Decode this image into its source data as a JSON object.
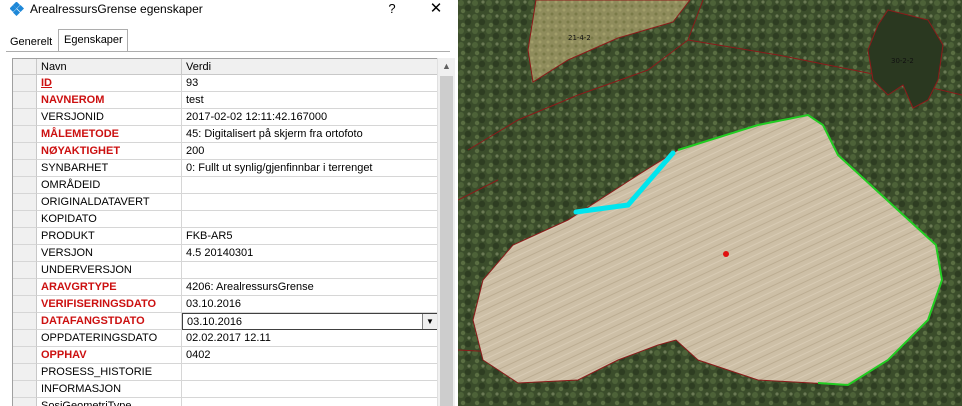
{
  "window": {
    "title": "ArealressursGrense egenskaper",
    "help_label": "?",
    "close_label": "✕",
    "icon": "diamond-app-icon"
  },
  "tabs": [
    {
      "label": "Generelt",
      "active": false
    },
    {
      "label": "Egenskaper",
      "active": true
    }
  ],
  "grid": {
    "headers": {
      "name": "Navn",
      "value": "Verdi"
    },
    "rows": [
      {
        "name": "ID",
        "value": "93",
        "required": true,
        "selected": true
      },
      {
        "name": "NAVNEROM",
        "value": "test",
        "required": true
      },
      {
        "name": "VERSJONID",
        "value": "2017-02-02 12:11:42.167000",
        "required": false
      },
      {
        "name": "MÅLEMETODE",
        "value": "45: Digitalisert på skjerm fra ortofoto",
        "required": true
      },
      {
        "name": "NØYAKTIGHET",
        "value": "200",
        "required": true
      },
      {
        "name": "SYNBARHET",
        "value": "0: Fullt ut synlig/gjenfinnbar i terrenget",
        "required": false
      },
      {
        "name": "OMRÅDEID",
        "value": "",
        "required": false
      },
      {
        "name": "ORIGINALDATAVERT",
        "value": "",
        "required": false
      },
      {
        "name": "KOPIDATO",
        "value": "",
        "required": false
      },
      {
        "name": "PRODUKT",
        "value": "FKB-AR5",
        "required": false
      },
      {
        "name": "VERSJON",
        "value": "4.5 20140301",
        "required": false
      },
      {
        "name": "UNDERVERSJON",
        "value": "",
        "required": false
      },
      {
        "name": "ARAVGRTYPE",
        "value": "4206: ArealressursGrense",
        "required": true
      },
      {
        "name": "VERIFISERINGSDATO",
        "value": "03.10.2016",
        "required": true
      },
      {
        "name": "DATAFANGSTDATO",
        "value": "03.10.2016",
        "required": true,
        "dropdown": true
      },
      {
        "name": "OPPDATERINGSDATO",
        "value": "02.02.2017 12.11",
        "required": false
      },
      {
        "name": "OPPHAV",
        "value": "0402",
        "required": true
      },
      {
        "name": "PROSESS_HISTORIE",
        "value": "",
        "required": false
      },
      {
        "name": "INFORMASJON",
        "value": "",
        "required": false
      },
      {
        "name": "SosiGeometriType",
        "value": "",
        "required": false
      }
    ]
  },
  "map": {
    "labels": [
      "21-4-2",
      "30-2-2"
    ],
    "colors": {
      "boundary": "#8b1a1a",
      "selected_edge": "#00e5ee",
      "highlight_edge": "#22cc22",
      "point": "#e01010",
      "field": "#c9b9a0",
      "forest": "#3c4e2c"
    }
  }
}
